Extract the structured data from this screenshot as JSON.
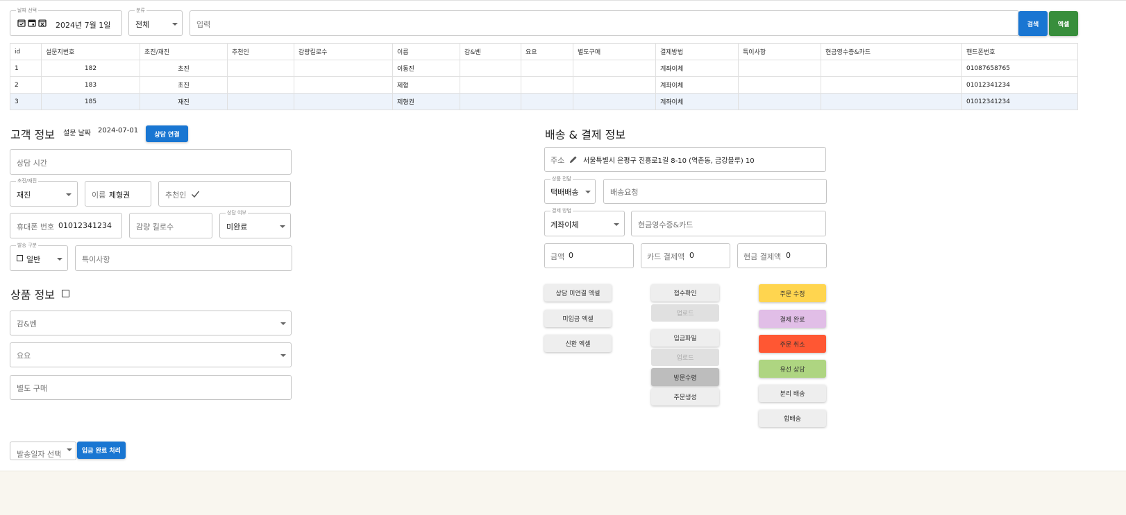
{
  "filters": {
    "date_legend": "날짜 선택",
    "date_value": "2024년 7월 1일",
    "category_legend": "분류",
    "category_value": "전체",
    "search_placeholder": "입력",
    "search_button": "검색",
    "excel_button": "엑셀"
  },
  "table": {
    "columns": [
      "id",
      "설문지번호",
      "초진/재진",
      "추천인",
      "감량킬로수",
      "이름",
      "감&벤",
      "요요",
      "별도구매",
      "결제방법",
      "특이사항",
      "현금영수증&카드",
      "핸드폰번호"
    ],
    "rows": [
      [
        "1",
        "182",
        "초진",
        "",
        "",
        "이동진",
        "",
        "",
        "",
        "계좌이체",
        "",
        "",
        "01087658765"
      ],
      [
        "2",
        "183",
        "초진",
        "",
        "",
        "제형",
        "",
        "",
        "",
        "계좌이체",
        "",
        "",
        "01012341234"
      ],
      [
        "3",
        "185",
        "재진",
        "",
        "",
        "제형권",
        "",
        "",
        "",
        "계좌이체",
        "",
        "",
        "01012341234"
      ]
    ]
  },
  "customer": {
    "title": "고객 정보",
    "survey_date_label": "설문 날짜",
    "survey_date": "2024-07-01",
    "consult_link_button": "상담 연결",
    "consult_time_placeholder": "상담 시간",
    "visit_type_legend": "초진/재진",
    "visit_type_value": "재진",
    "name_label": "이름",
    "name_value": "제형권",
    "referrer_label": "추천인",
    "phone_label": "휴대폰 번호",
    "phone_value": "01012341234",
    "weight_loss_placeholder": "감량 킬로수",
    "consult_status_legend": "상담 여부",
    "consult_status_value": "미완료",
    "shipping_type_legend": "발송 구분",
    "shipping_type_value": "일반",
    "notes_placeholder": "특이사항"
  },
  "product": {
    "title": "상품 정보",
    "gamben_placeholder": "감&벤",
    "yoyo_placeholder": "요요",
    "extra_purchase_placeholder": "별도 구매"
  },
  "bottom": {
    "ship_date_placeholder": "발송일자 선택",
    "deposit_done_button": "입금 완료 처리"
  },
  "delivery": {
    "title": "배송 & 결제 정보",
    "address_label": "주소",
    "address_value": "서울특별시 은평구 진흥로1길 8-10 (역촌동, 금강블루) 10",
    "delivery_method_legend": "상품 전달",
    "delivery_method_value": "택배배송",
    "delivery_request_placeholder": "배송요청",
    "payment_method_legend": "결제 방법",
    "payment_method_value": "계좌이체",
    "receipt_placeholder": "현금영수증&카드",
    "amount_label": "금액",
    "amount_value": "0",
    "card_amount_label": "카드 결제액",
    "card_amount_value": "0",
    "cash_amount_label": "현금 결제액",
    "cash_amount_value": "0"
  },
  "actions": {
    "col1": [
      "상담 미연결 엑셀",
      "미입금 엑셀",
      "신환 엑셀"
    ],
    "col2": [
      "접수확인",
      "업로드",
      "입금파일",
      "업로드",
      "방문수령",
      "주문생성"
    ],
    "col3": [
      "주문 수정",
      "결제 완료",
      "주문 취소",
      "유선 상담",
      "분리 배송",
      "합배송"
    ]
  },
  "colors": {
    "primary": "#1976d2",
    "excel_green": "#388e3c",
    "order_edit": "#ffd54f",
    "payment_done": "#e1bee7",
    "order_cancel": "#ff5733",
    "phone_consult": "#aed581"
  }
}
